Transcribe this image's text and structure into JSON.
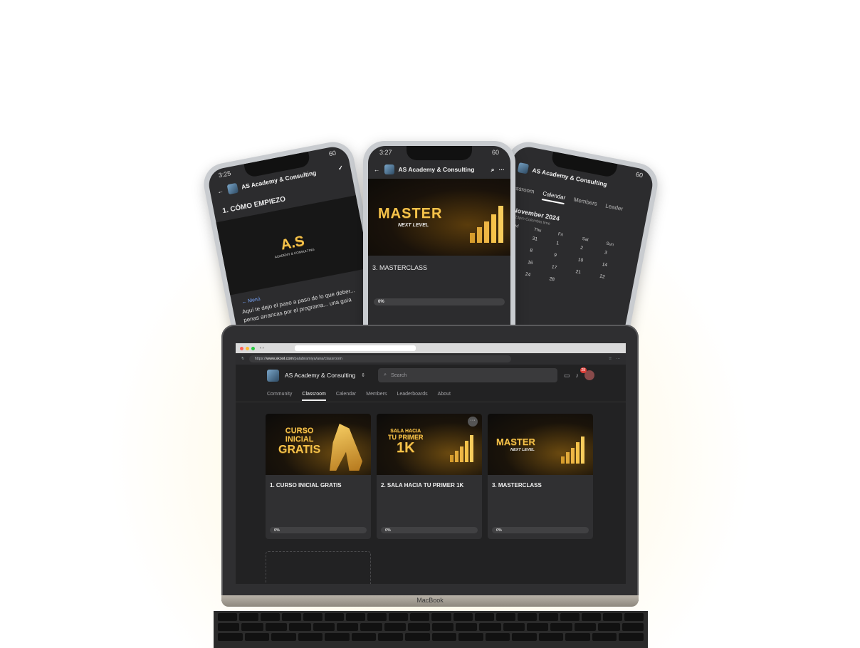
{
  "phones": {
    "left": {
      "community": "AS Academy & Consulting",
      "lesson_title": "1. CÓMO EMPIEZO",
      "logo_text": "A.S",
      "logo_sub": "ACADEMY & CONSULTING",
      "menu": "Menú",
      "body_text": "Aquí te dejo el paso a paso de lo que deber... penas arrancas por el programa... una guía práct..."
    },
    "center": {
      "time": "3:27",
      "battery": "60",
      "community": "AS Academy & Consulting",
      "banner_title": "MASTER",
      "banner_sub": "NEXT LEVEL",
      "course_title": "3. MASTERCLASS",
      "progress": "0%"
    },
    "right": {
      "community": "AS Academy & Consulting",
      "tab_prev": "assroom",
      "tab_active": "Calendar",
      "tab_members": "Members",
      "tab_next": "Leader",
      "month": "November 2024",
      "timezone": "1:23pm Colombia time",
      "weekdays": [
        "Wed",
        "Thu",
        "Fri",
        "Sat",
        "Sun"
      ],
      "days": [
        "30",
        "31",
        "1",
        "2",
        "3",
        "7",
        "8",
        "9",
        "10",
        "14",
        "15",
        "16",
        "17",
        "21",
        "22",
        "23",
        "24",
        "28"
      ]
    }
  },
  "laptop": {
    "brand": "MacBook",
    "browser": {
      "url_prefix": "https://",
      "url_domain": "www.skool.com",
      "url_path": "/palabramiya/ana/classroom"
    },
    "header": {
      "community_name": "AS Academy & Consulting",
      "search_placeholder": "Search",
      "notification_count": "28"
    },
    "tabs": [
      {
        "label": "Community"
      },
      {
        "label": "Classroom"
      },
      {
        "label": "Calendar"
      },
      {
        "label": "Members"
      },
      {
        "label": "Leaderboards"
      },
      {
        "label": "About"
      }
    ],
    "courses": [
      {
        "title": "1. CURSO INICIAL GRATIS",
        "banner_line1": "CURSO",
        "banner_line2": "INICIAL",
        "banner_line3": "GRATIS",
        "progress": "0%"
      },
      {
        "title": "2. SALA HACIA TU PRIMER 1K",
        "banner_line1": "SALA HACIA",
        "banner_line2": "TU PRIMER",
        "banner_line3": "1K",
        "progress": "0%"
      },
      {
        "title": "3. MASTERCLASS",
        "banner_line1": "MASTER",
        "banner_line2": "NEXT LEVEL",
        "banner_line3": "",
        "progress": "0%"
      }
    ]
  }
}
